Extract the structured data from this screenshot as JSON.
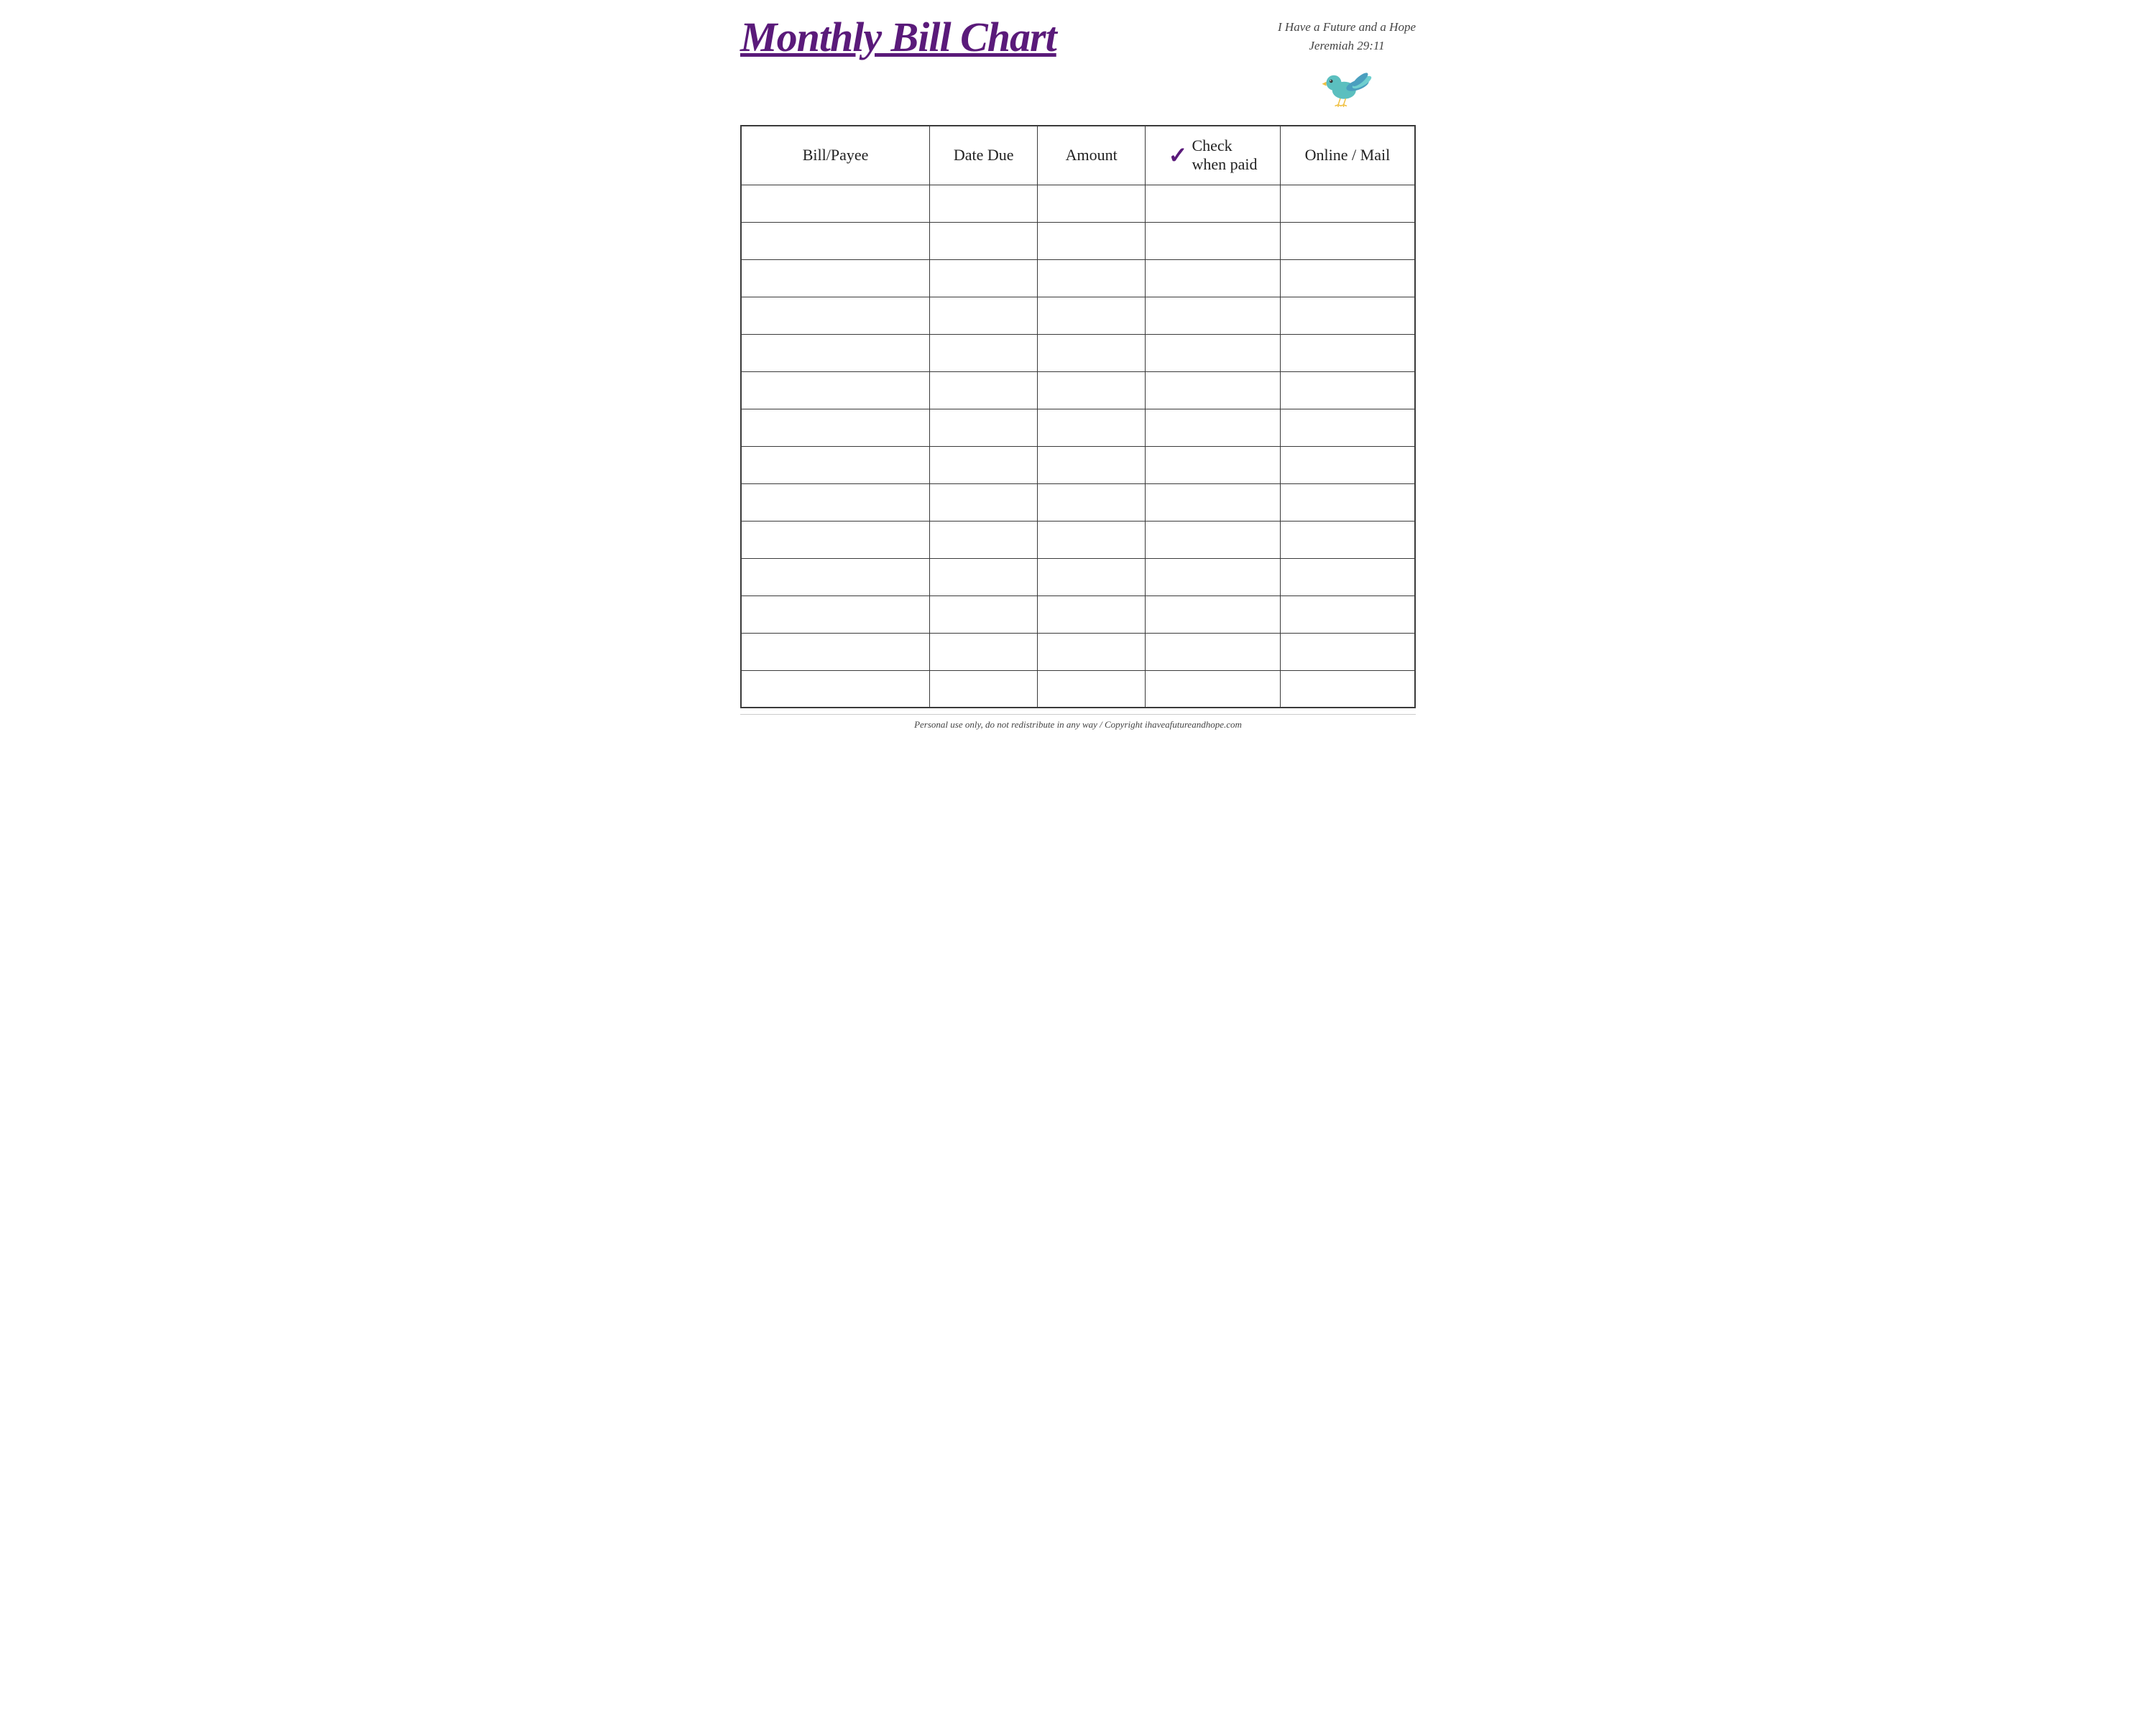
{
  "header": {
    "title": "Monthly Bill Chart",
    "tagline_line1": "I Have a Future and a Hope",
    "tagline_line2": "Jeremiah 29:11"
  },
  "table": {
    "columns": [
      {
        "id": "bill-payee",
        "label": "Bill/Payee"
      },
      {
        "id": "date-due",
        "label": "Date Due"
      },
      {
        "id": "amount",
        "label": "Amount"
      },
      {
        "id": "check-when-paid",
        "label": "Check when paid",
        "has_checkmark": true
      },
      {
        "id": "online-mail",
        "label": "Online / Mail"
      }
    ],
    "row_count": 14
  },
  "footer": {
    "text": "Personal use only, do not redistribute in any way / Copyright ihaveafutureandhope.com"
  },
  "colors": {
    "title": "#5a1a7a",
    "checkmark": "#5a1a7a",
    "border": "#3a3a3a",
    "text": "#222222"
  }
}
